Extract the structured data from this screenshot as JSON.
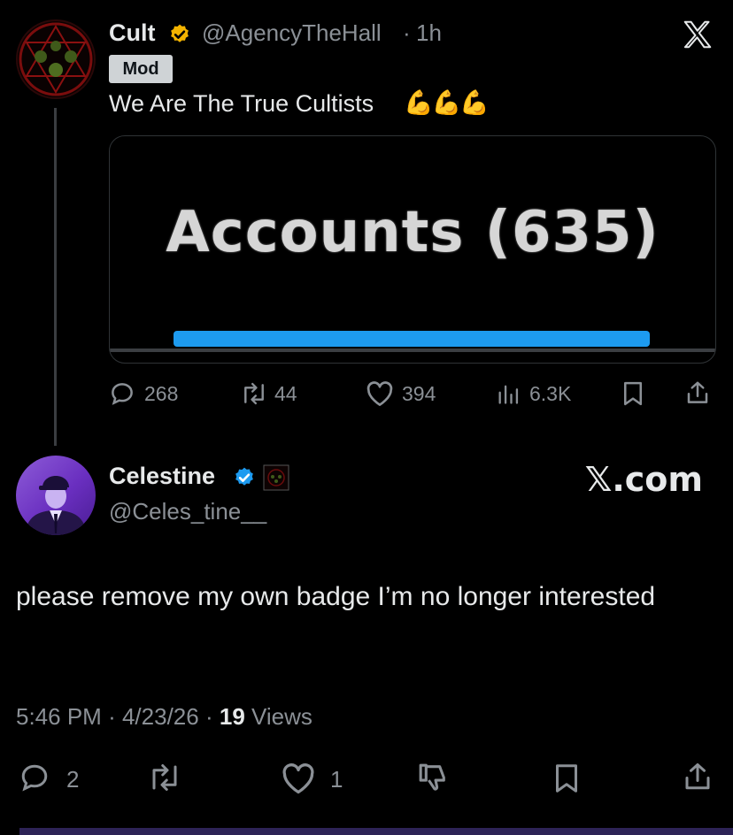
{
  "parent_tweet": {
    "author_name": "Cult",
    "author_handle": "@AgencyTheHall",
    "separator": "·",
    "time": "1h",
    "mod_badge": "Mod",
    "text": "We Are The True Cultists",
    "text_emoji": "💪💪💪",
    "media_text": "Accounts (635)",
    "actions": {
      "replies": "268",
      "reposts": "44",
      "likes": "394",
      "views": "6.3K"
    }
  },
  "reply": {
    "author_name": "Celestine",
    "author_handle": "@Celes_tine__",
    "text": "please remove my own badge I’m no longer interested",
    "time": "5:46 PM",
    "date": "4/23/26",
    "sep": "·",
    "views_count": "19",
    "views_label": "Views",
    "watermark": "𝕏.com",
    "actions": {
      "replies": "2",
      "likes": "1"
    }
  },
  "colors": {
    "background": "#000000",
    "text": "#e7e9ea",
    "secondary": "#8b9096",
    "accent": "#1d9bf0",
    "gold_badge": "#f4b400"
  },
  "icons": [
    "x-logo-icon",
    "verified-gold-icon",
    "verified-blue-icon",
    "reply-icon",
    "repost-icon",
    "like-icon",
    "views-icon",
    "bookmark-icon",
    "share-icon",
    "dislike-icon"
  ]
}
